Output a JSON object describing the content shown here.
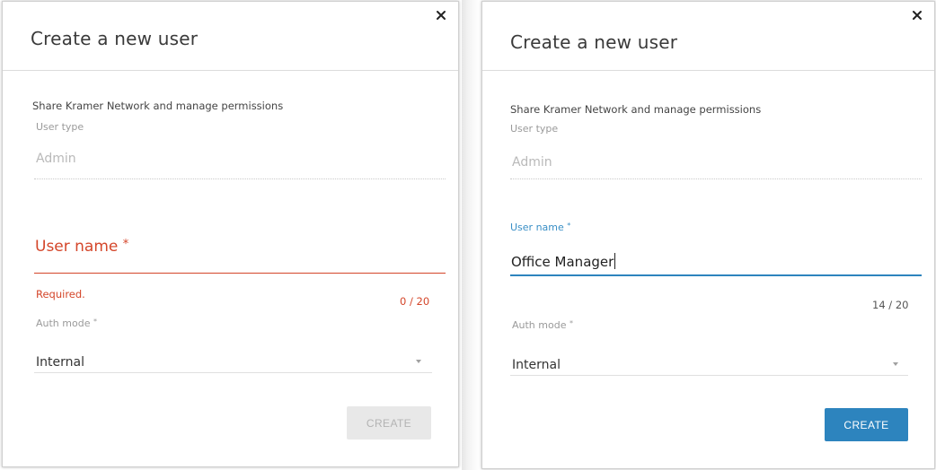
{
  "dialogs": [
    {
      "title": "Create a new user",
      "share_text": "Share Kramer Network and manage permissions",
      "user_type": {
        "label": "User type",
        "value": "Admin"
      },
      "user_name": {
        "label": "User name",
        "required_mark": "*",
        "value": "",
        "error": "Required.",
        "counter": "0 / 20",
        "state": "error"
      },
      "auth_mode": {
        "label": "Auth mode",
        "required_mark": "*",
        "value": "Internal"
      },
      "create_button": {
        "label": "CREATE",
        "enabled": false
      }
    },
    {
      "title": "Create a new user",
      "share_text": "Share Kramer Network and manage permissions",
      "user_type": {
        "label": "User type",
        "value": "Admin"
      },
      "user_name": {
        "label": "User name",
        "required_mark": "*",
        "value": "Office Manager",
        "counter": "14 / 20",
        "state": "focused"
      },
      "auth_mode": {
        "label": "Auth mode",
        "required_mark": "*",
        "value": "Internal"
      },
      "create_button": {
        "label": "CREATE",
        "enabled": true
      }
    }
  ],
  "icons": {
    "close": "close-icon",
    "dropdown": "caret-down-icon"
  },
  "colors": {
    "error": "#d4462a",
    "primary": "#2d84be",
    "focus_label": "#3a8fc6"
  }
}
